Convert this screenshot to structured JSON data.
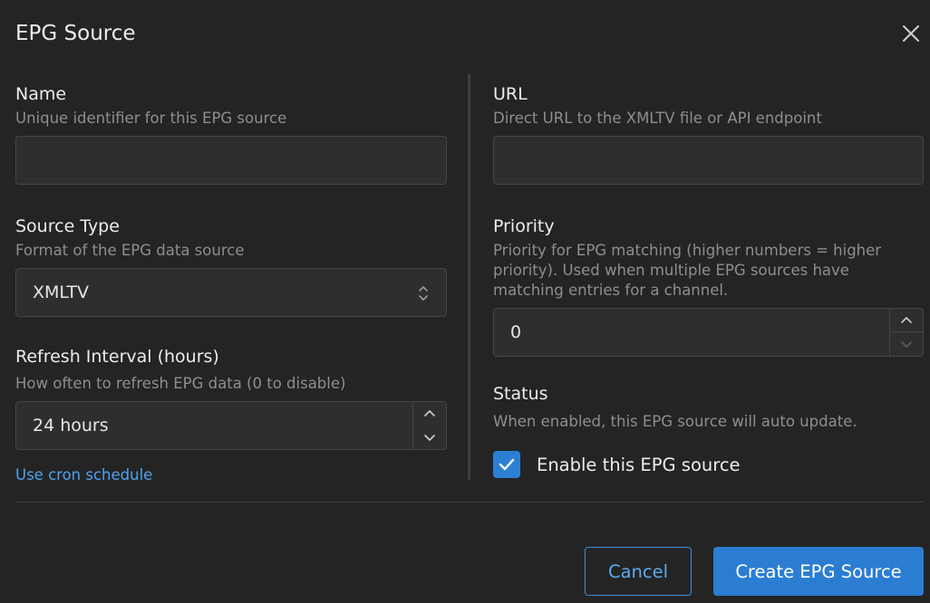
{
  "dialog": {
    "title": "EPG Source"
  },
  "fields": {
    "name": {
      "label": "Name",
      "help": "Unique identifier for this EPG source",
      "value": ""
    },
    "source_type": {
      "label": "Source Type",
      "help": "Format of the EPG data source",
      "value": "XMLTV"
    },
    "refresh_interval": {
      "label": "Refresh Interval (hours)",
      "help": "How often to refresh EPG data (0 to disable)",
      "value": "24 hours"
    },
    "cron_link": "Use cron schedule",
    "url": {
      "label": "URL",
      "help": "Direct URL to the XMLTV file or API endpoint",
      "value": ""
    },
    "priority": {
      "label": "Priority",
      "help": "Priority for EPG matching (higher numbers = higher priority). Used when multiple EPG sources have matching entries for a channel.",
      "value": "0"
    },
    "status": {
      "label": "Status",
      "help": "When enabled, this EPG source will auto update.",
      "checkbox_label": "Enable this EPG source",
      "checked": true
    }
  },
  "buttons": {
    "cancel": "Cancel",
    "create": "Create EPG Source"
  },
  "icons": {
    "close": "close-icon",
    "select": "chevron-up-down-icon",
    "stepper_up": "chevron-up-icon",
    "stepper_down": "chevron-down-icon",
    "check": "check-icon"
  },
  "colors": {
    "background": "#242424",
    "accent": "#2b7dd2",
    "link": "#4ea3f1",
    "help_text": "#8e8e8e"
  }
}
